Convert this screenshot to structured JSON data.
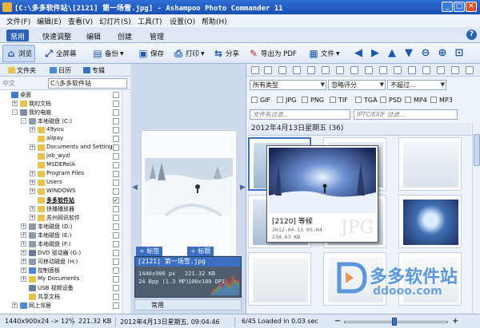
{
  "window": {
    "title": "[C:\\多多软件站\\[2121] 第一场雪.jpg] - Ashampoo Photo Commander 11",
    "minimize": "_",
    "maximize": "□",
    "close": "✕"
  },
  "menu": [
    "文件(F)",
    "编辑(E)",
    "查看(V)",
    "幻灯片(S)",
    "工具(T)",
    "设置(O)",
    "帮助(H)"
  ],
  "tabs": [
    "常用",
    "快速调整",
    "编辑",
    "创建",
    "管理"
  ],
  "help_icon": "?",
  "toolbar": {
    "browse": "浏览",
    "fullscreen": "全屏幕",
    "backup": "备份",
    "save": "保存",
    "print": "打印",
    "share": "分享",
    "export_pdf": "导出为 PDF",
    "file": "文件"
  },
  "left_panel": {
    "tabs": [
      "文件夹",
      "日历",
      "专辑"
    ],
    "path_label": "中文",
    "path_value": "C:\\多多软件站",
    "tree": [
      {
        "label": "桌面",
        "level": 0,
        "expander": "",
        "icon_color": "#3f7bd6",
        "checked": false,
        "bold": false
      },
      {
        "label": "我的文档",
        "level": 1,
        "expander": "+",
        "icon_color": "#e8c24a",
        "checked": false,
        "bold": false
      },
      {
        "label": "我的电脑",
        "level": 1,
        "expander": "-",
        "icon_color": "#7a8ba3",
        "checked": false,
        "bold": false
      },
      {
        "label": "本地磁盘 (C:)",
        "level": 2,
        "expander": "-",
        "icon_color": "#8e9aab",
        "checked": false,
        "bold": false
      },
      {
        "label": "49you",
        "level": 3,
        "expander": "+",
        "icon_color": "#e8c24a",
        "checked": false,
        "bold": false
      },
      {
        "label": "alipay",
        "level": 3,
        "expander": "",
        "icon_color": "#e8c24a",
        "checked": false,
        "bold": false
      },
      {
        "label": "Documents and Settings",
        "level": 3,
        "expander": "+",
        "icon_color": "#e8c24a",
        "checked": false,
        "bold": false
      },
      {
        "label": "job_wyzl",
        "level": 3,
        "expander": "",
        "icon_color": "#e8c24a",
        "checked": false,
        "bold": false
      },
      {
        "label": "MSDERelA",
        "level": 3,
        "expander": "",
        "icon_color": "#e8c24a",
        "checked": false,
        "bold": false
      },
      {
        "label": "Program Files",
        "level": 3,
        "expander": "+",
        "icon_color": "#e8c24a",
        "checked": false,
        "bold": false
      },
      {
        "label": "Users",
        "level": 3,
        "expander": "+",
        "icon_color": "#e8c24a",
        "checked": false,
        "bold": false
      },
      {
        "label": "WINDOWS",
        "level": 3,
        "expander": "+",
        "icon_color": "#e8c24a",
        "checked": false,
        "bold": false
      },
      {
        "label": "多多软件站",
        "level": 3,
        "expander": "",
        "icon_color": "#e8c24a",
        "checked": true,
        "bold": true
      },
      {
        "label": "快播播放器",
        "level": 3,
        "expander": "+",
        "icon_color": "#e8c24a",
        "checked": false,
        "bold": false
      },
      {
        "label": "苏州网讯软件",
        "level": 3,
        "expander": "+",
        "icon_color": "#e8c24a",
        "checked": false,
        "bold": false
      },
      {
        "label": "本地磁盘 (D:)",
        "level": 2,
        "expander": "+",
        "icon_color": "#8e9aab",
        "checked": false,
        "bold": false
      },
      {
        "label": "本地磁盘 (E:)",
        "level": 2,
        "expander": "+",
        "icon_color": "#8e9aab",
        "checked": false,
        "bold": false
      },
      {
        "label": "本地磁盘 (F:)",
        "level": 2,
        "expander": "+",
        "icon_color": "#8e9aab",
        "checked": false,
        "bold": false
      },
      {
        "label": "DVD 驱动器 (G:)",
        "level": 2,
        "expander": "+",
        "icon_color": "#6a7f9c",
        "checked": false,
        "bold": false
      },
      {
        "label": "可移动磁盘 (H:)",
        "level": 2,
        "expander": "+",
        "icon_color": "#8e9aab",
        "checked": false,
        "bold": false
      },
      {
        "label": "控制面板",
        "level": 2,
        "expander": "+",
        "icon_color": "#4a8ad6",
        "checked": false,
        "bold": false
      },
      {
        "label": "My Documents",
        "level": 2,
        "expander": "+",
        "icon_color": "#e8c24a",
        "checked": false,
        "bold": false
      },
      {
        "label": "USB 视频设备",
        "level": 2,
        "expander": "",
        "icon_color": "#6a7f9c",
        "checked": false,
        "bold": false
      },
      {
        "label": "共享文档",
        "level": 2,
        "expander": "",
        "icon_color": "#e8c24a",
        "checked": false,
        "bold": false
      },
      {
        "label": "网上邻居",
        "level": 1,
        "expander": "+",
        "icon_color": "#4a8ad6",
        "checked": false,
        "bold": false
      }
    ]
  },
  "center_panel": {
    "tag_btn1": "+ 标签",
    "tag_btn2": "+ 标题",
    "info_title": "[2121] 第一场雪.jpg",
    "info_dims": "1440x900 px",
    "info_size": "221.32 KB",
    "info_depth": "24 Bpp (1.3 MP)",
    "info_dpi": "100x100 DPI",
    "bottom_label": "常用"
  },
  "right_panel": {
    "type_filter": "所有类型",
    "rating_filter": "忽略评分",
    "date_filter": "不超过...",
    "file_types": [
      "GIF",
      "JPG",
      "PNG",
      "TIF",
      "TGA",
      "PSD",
      "MP4",
      "MP3"
    ],
    "name_filter_placeholder": "文件名过滤...",
    "iptc_filter_placeholder": "IPTC/EXIF 过滤...",
    "group_header": "2012年4月13日星期五  (36)",
    "popup_title": "[2120] 等候",
    "popup_date": "2012-04-13 05:04",
    "popup_size": "238.63 KB",
    "popup_badge": "JPG"
  },
  "watermark": {
    "brand": "多多软件站",
    "url": "ddooo.com"
  },
  "status": {
    "dims": "1440x900x24 -> 12%",
    "filesize": "221.32 KB",
    "date": "2012年4月13日星期五, 09:04:46",
    "loaded": "6/45  Loaded in 0.03 sec",
    "zoom_minus": "−",
    "zoom_plus": "+"
  },
  "colors": {
    "titlebar": "#1f5ac2",
    "accent": "#2d62b8",
    "popup_title": "#000000"
  }
}
